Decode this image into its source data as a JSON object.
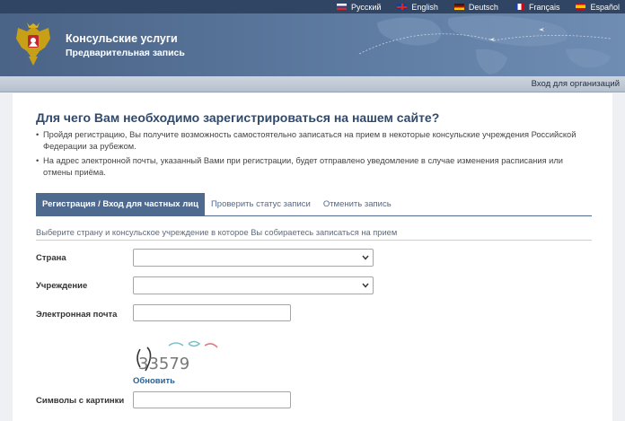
{
  "languages": [
    {
      "label": "Русский",
      "flag": "ru-flag-icon"
    },
    {
      "label": "English",
      "flag": "uk-flag-icon"
    },
    {
      "label": "Deutsch",
      "flag": "de-flag-icon"
    },
    {
      "label": "Français",
      "flag": "fr-flag-icon"
    },
    {
      "label": "Español",
      "flag": "es-flag-icon"
    }
  ],
  "header": {
    "title": "Консульские услуги",
    "subtitle": "Предварительная запись"
  },
  "subbar": {
    "org_login": "Вход для организаций"
  },
  "main": {
    "heading": "Для чего Вам необходимо зарегистрироваться на нашем сайте?",
    "bullets": [
      "Пройдя регистрацию, Вы получите возможность самостоятельно записаться на прием в некоторые консульские учреждения Российской Федерации за рубежом.",
      "На адрес электронной почты, указанный Вами при регистрации, будет отправлено уведомление в случае изменения расписания или отмены приёма."
    ],
    "tabs": [
      {
        "label": "Регистрация / Вход для частных лиц",
        "active": true
      },
      {
        "label": "Проверить статус записи",
        "active": false
      },
      {
        "label": "Отменить запись",
        "active": false
      }
    ],
    "instruction": "Выберите страну и консульское учреждение в которое Вы собираетесь записаться на прием"
  },
  "form": {
    "country_label": "Страна",
    "country_value": "",
    "institution_label": "Учреждение",
    "institution_value": "",
    "email_label": "Электронная почта",
    "email_value": "",
    "captcha_text": "33579",
    "refresh_label": "Обновить",
    "symbols_label": "Символы с картинки",
    "symbols_value": ""
  },
  "colors": {
    "header_blue": "#4a6386",
    "accent_tab": "#4f6a8f",
    "heading": "#2f4a6d",
    "link": "#2f5f8f"
  }
}
